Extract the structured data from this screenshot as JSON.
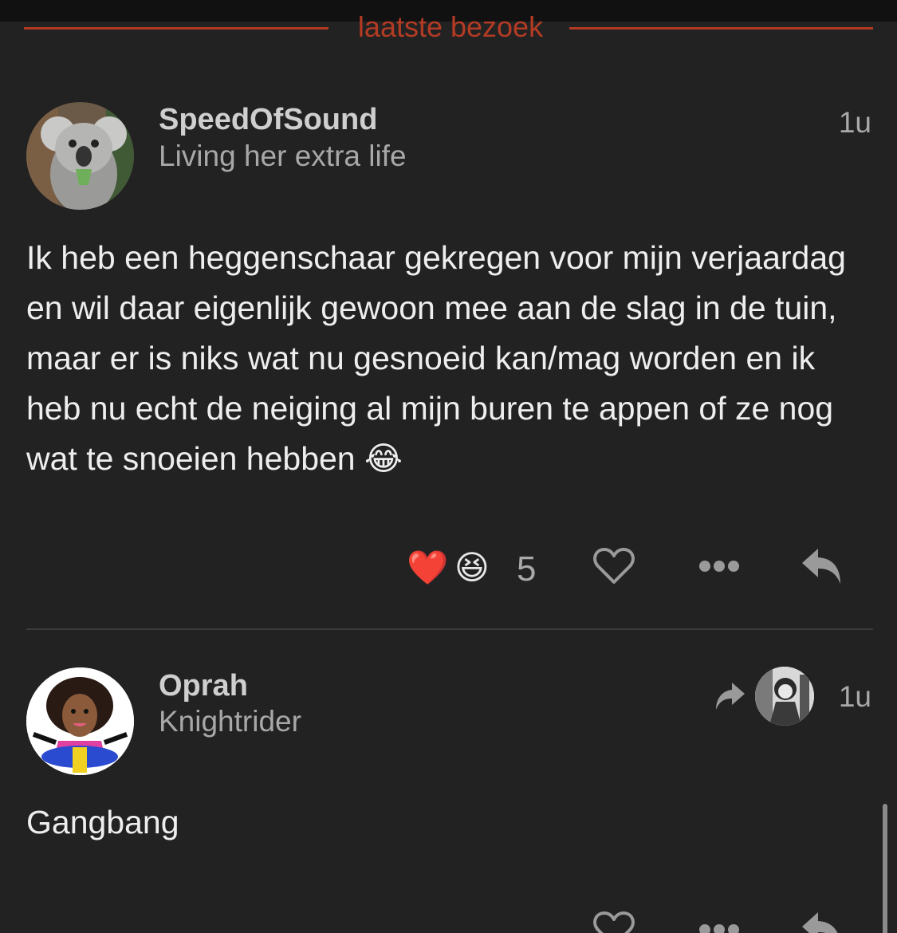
{
  "divider": {
    "label": "laatste bezoek"
  },
  "posts": [
    {
      "username": "SpeedOfSound",
      "user_title": "Living her extra life",
      "time": "1u",
      "body": "Ik heb een heggenschaar gekregen voor mijn verjaardag en wil daar eigenlijk gewoon mee aan de slag in de tuin, maar er is niks wat nu gesnoeid kan/mag worden en ik heb nu echt de neiging al mijn buren te appen of ze nog wat te snoeien hebben 😂",
      "reactions": {
        "emojis": [
          "❤️",
          "😆"
        ],
        "count": "5"
      }
    },
    {
      "username": "Oprah",
      "user_title": "Knightrider",
      "time": "1u",
      "body": "Gangbang"
    }
  ],
  "colors": {
    "background": "#222222",
    "accent": "#b33b24",
    "muted_text": "#a8a8a8"
  },
  "icons": [
    "koala-avatar",
    "cartoon-avatar",
    "heart-icon",
    "more-icon",
    "reply-icon",
    "reply-to-icon",
    "photo-avatar"
  ]
}
